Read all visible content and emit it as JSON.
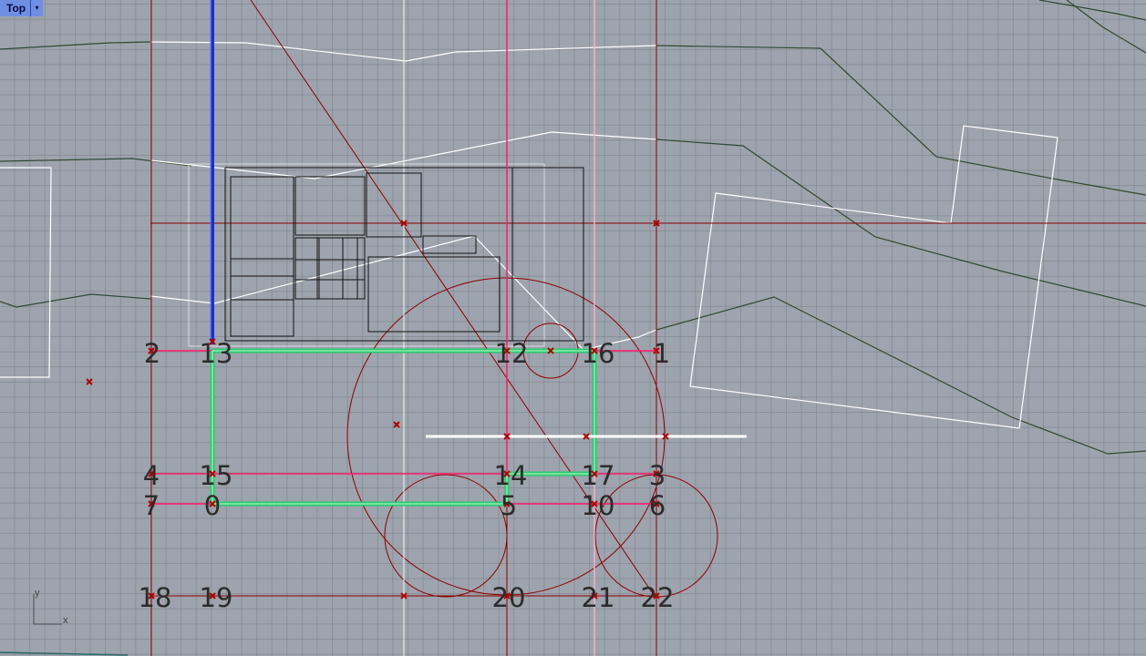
{
  "viewport": {
    "name": "Top",
    "menu_arrow": "▾",
    "axis_labels": {
      "x": "x",
      "y": "y"
    },
    "point_labels": [
      "0",
      "1",
      "2",
      "3",
      "4",
      "5",
      "6",
      "7",
      "10",
      "12",
      "13",
      "14",
      "15",
      "16",
      "17",
      "18",
      "19",
      "20",
      "21",
      "22"
    ]
  },
  "colors": {
    "background": "#9ea4ad",
    "grid_line": "#787e88",
    "dark_red": "#8b0000",
    "pink": "#ff1a6c",
    "light_pink": "#ffb0c8",
    "green": "#2fc870",
    "blue": "#1a2fd8",
    "white": "#ffffff",
    "dark_green": "#2f4a30",
    "black": "#111111"
  }
}
